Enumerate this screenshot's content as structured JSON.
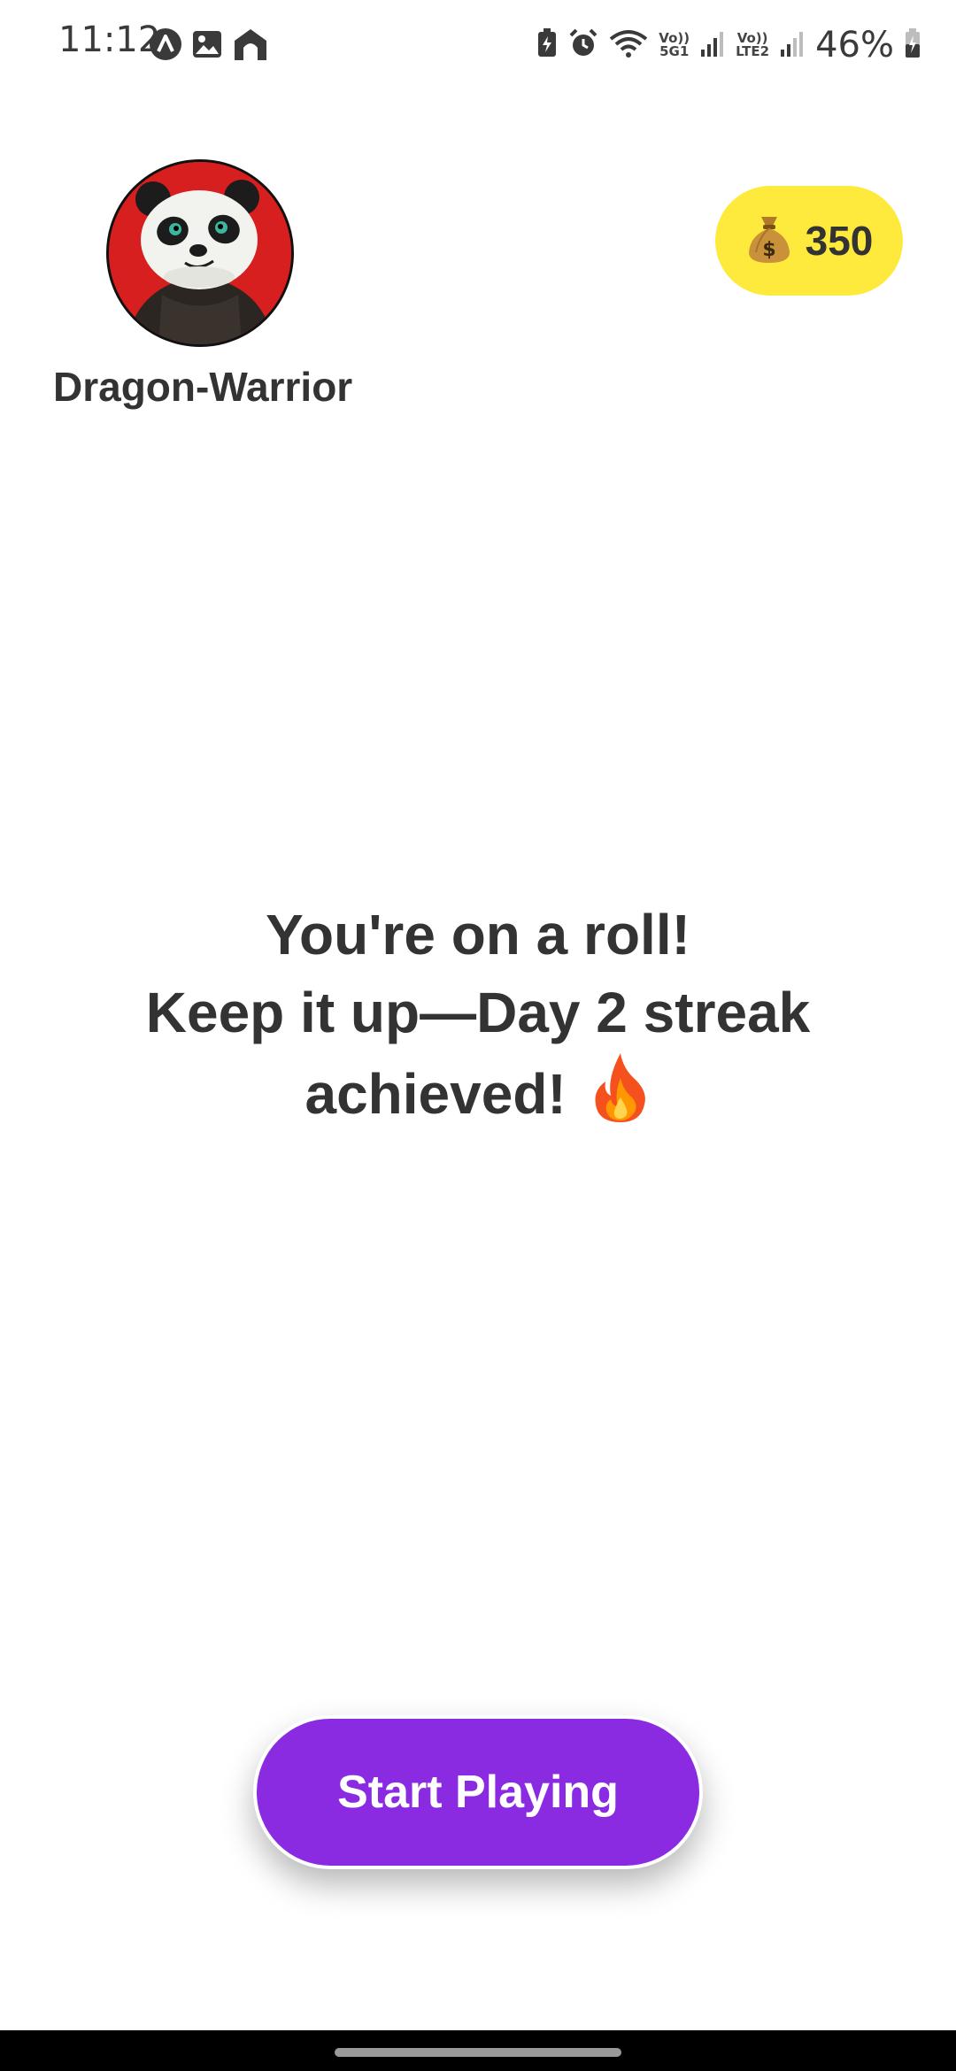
{
  "status_bar": {
    "time": "11:12",
    "left_icons": [
      "app-a-icon",
      "gallery-icon",
      "home-app-icon"
    ],
    "right_icons": [
      "battery-saver-icon",
      "alarm-icon",
      "wifi-icon",
      "signal-sim1-icon",
      "signal-sim2-icon",
      "battery-icon"
    ],
    "sim1_label_top": "Vo))",
    "sim1_label_bottom": "5G1",
    "sim2_label_top": "Vo))",
    "sim2_label_bottom": "LTE2",
    "battery_percent": "46%"
  },
  "profile": {
    "username": "Dragon-Warrior",
    "avatar": "panda-avatar"
  },
  "coins": {
    "icon": "money-bag-icon",
    "amount": "350",
    "badge_color": "#fdea3d"
  },
  "message": {
    "line1": "You're on a roll!",
    "line2": "Keep it up—Day 2 streak",
    "line3": "achieved!",
    "emoji": "fire-icon"
  },
  "actions": {
    "start_label": "Start Playing",
    "button_color": "#8a2be2"
  }
}
